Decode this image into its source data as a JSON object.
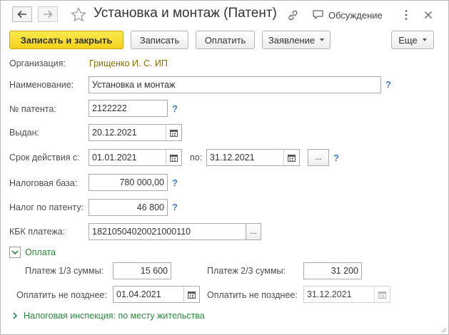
{
  "window": {
    "title": "Установка и монтаж (Патент)",
    "discussion_label": "Обсуждение"
  },
  "icons": {
    "back": "arrow-left-icon",
    "forward": "arrow-right-icon",
    "favorite": "star-icon",
    "link": "link-icon",
    "discussion": "speech-bubble-icon",
    "more": "vertical-ellipsis-icon",
    "close": "close-icon",
    "calendar": "calendar-icon"
  },
  "toolbar": {
    "save_close": "Записать и закрыть",
    "save": "Записать",
    "pay": "Оплатить",
    "statement": "Заявление",
    "more": "Еще"
  },
  "form": {
    "organization": {
      "label": "Организация:",
      "value": "Грищенко И. С. ИП"
    },
    "name": {
      "label": "Наименование:",
      "value": "Установка и монтаж"
    },
    "patent_no": {
      "label": "№ патента:",
      "value": "2122222"
    },
    "issued": {
      "label": "Выдан:",
      "value": "20.12.2021"
    },
    "validity": {
      "label": "Срок действия с:",
      "from": "01.01.2021",
      "to_label": "по:",
      "to": "31.12.2021",
      "select_label": "..."
    },
    "tax_base": {
      "label": "Налоговая база:",
      "value": "780 000,00"
    },
    "patent_tax": {
      "label": "Налог по патенту:",
      "value": "46 800"
    },
    "kbk": {
      "label": "КБК платежа:",
      "value": "18210504020021000110",
      "select_label": "..."
    },
    "help": "?"
  },
  "payment": {
    "group_title": "Оплата",
    "first_label": "Платеж 1/3 суммы:",
    "first_value": "15 600",
    "second_label": "Платеж 2/3 суммы:",
    "second_value": "31 200",
    "due_label_1": "Оплатить не позднее:",
    "due_value_1": "01.04.2021",
    "due_label_2": "Оплатить не позднее:",
    "due_value_2": "31.12.2021"
  },
  "inspection": {
    "group_title": "Налоговая инспекция: по месту жительства"
  },
  "colors": {
    "primary_button": "#f3d21b",
    "help_link": "#3a7fc1",
    "group_title": "#2a8a3c",
    "organization_link": "#8a6d00"
  }
}
